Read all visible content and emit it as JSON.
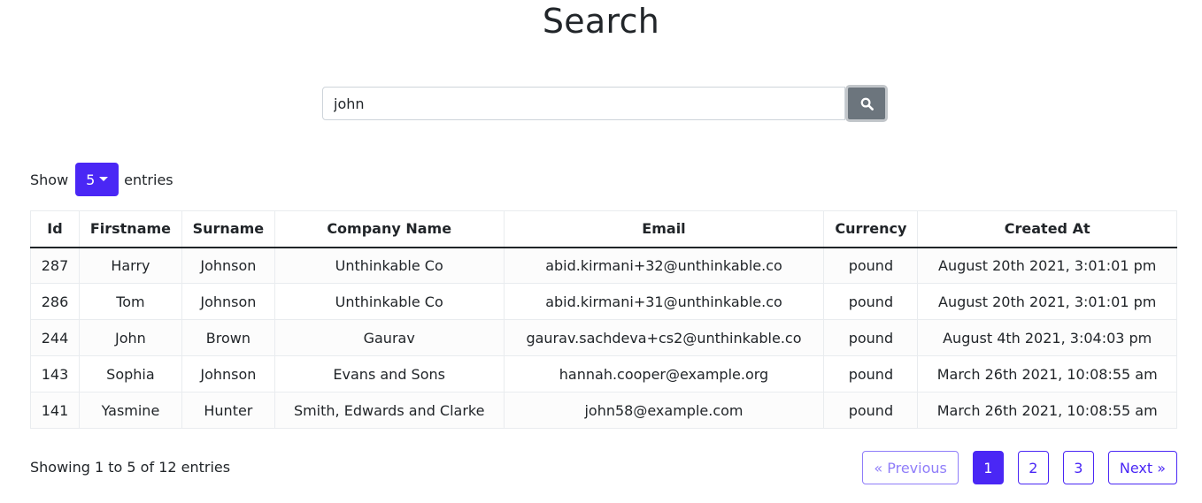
{
  "header": {
    "title": "Search"
  },
  "search": {
    "value": "john",
    "button_icon": "search-icon"
  },
  "length": {
    "prefix": "Show",
    "selected": "5",
    "suffix": "entries"
  },
  "table": {
    "columns": [
      "Id",
      "Firstname",
      "Surname",
      "Company Name",
      "Email",
      "Currency",
      "Created At"
    ],
    "rows": [
      [
        "287",
        "Harry",
        "Johnson",
        "Unthinkable Co",
        "abid.kirmani+32@unthinkable.co",
        "pound",
        "August 20th 2021, 3:01:01 pm"
      ],
      [
        "286",
        "Tom",
        "Johnson",
        "Unthinkable Co",
        "abid.kirmani+31@unthinkable.co",
        "pound",
        "August 20th 2021, 3:01:01 pm"
      ],
      [
        "244",
        "John",
        "Brown",
        "Gaurav",
        "gaurav.sachdeva+cs2@unthinkable.co",
        "pound",
        "August 4th 2021, 3:04:03 pm"
      ],
      [
        "143",
        "Sophia",
        "Johnson",
        "Evans and Sons",
        "hannah.cooper@example.org",
        "pound",
        "March 26th 2021, 10:08:55 am"
      ],
      [
        "141",
        "Yasmine",
        "Hunter",
        "Smith, Edwards and Clarke",
        "john58@example.com",
        "pound",
        "March 26th 2021, 10:08:55 am"
      ]
    ]
  },
  "info": "Showing 1 to 5 of 12 entries",
  "pagination": {
    "previous": "« Previous",
    "pages": [
      "1",
      "2",
      "3"
    ],
    "active_page": "1",
    "next": "Next »"
  },
  "colors": {
    "accent": "#4a27f5",
    "search_button": "#6c757d"
  }
}
